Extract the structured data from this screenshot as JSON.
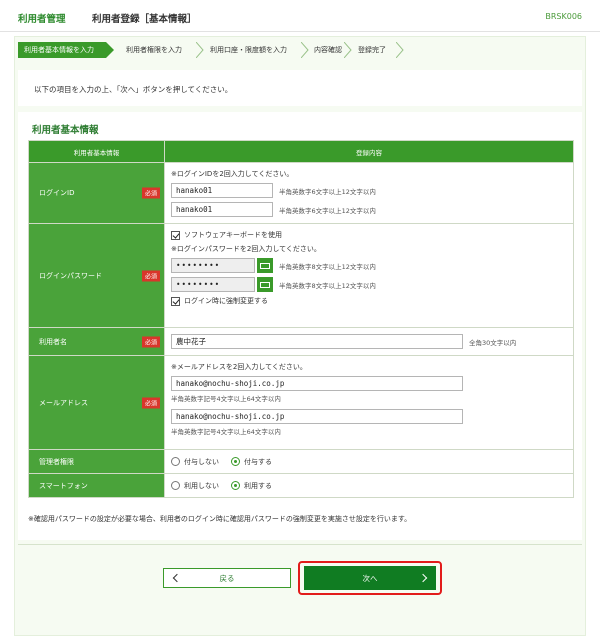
{
  "header": {
    "app_name": "利用者管理",
    "page_title": "利用者登録［基本情報］",
    "screen_code": "BRSK006"
  },
  "steps": [
    {
      "label": "利用者基本情報を入力",
      "active": true
    },
    {
      "label": "利用者権限を入力",
      "active": false
    },
    {
      "label": "利用口座・限度額を入力",
      "active": false
    },
    {
      "label": "内容確認",
      "active": false
    },
    {
      "label": "登録完了",
      "active": false
    }
  ],
  "intro": "以下の項目を入力の上、「次へ」ボタンを押してください。",
  "section_title": "利用者基本情報",
  "table": {
    "col_item": "利用者基本情報",
    "col_content": "登録内容"
  },
  "required_badge": "必須",
  "login_id": {
    "label": "ログインID",
    "note": "※ログインIDを2回入力してください。",
    "value1": "hanako01",
    "value2": "hanako01",
    "hint": "半角英数字6文字以上12文字以内"
  },
  "login_password": {
    "label": "ログインパスワード",
    "software_keyboard": "ソフトウェアキーボードを使用",
    "note": "※ログインパスワードを2回入力してください。",
    "value1": "••••••••",
    "value2": "••••••••",
    "hint": "半角英数字8文字以上12文字以内",
    "force_change": "ログイン時に強制変更する"
  },
  "user_name": {
    "label": "利用者名",
    "value": "農中花子",
    "hint": "全角30文字以内"
  },
  "email": {
    "label": "メールアドレス",
    "note": "※メールアドレスを2回入力してください。",
    "value1": "hanako@nochu-shoji.co.jp",
    "value2": "hanako@nochu-shoji.co.jp",
    "hint": "半角英数字記号4文字以上64文字以内"
  },
  "admin": {
    "label": "管理者権限",
    "option_off": "付与しない",
    "option_on": "付与する"
  },
  "smartphone": {
    "label": "スマートフォン",
    "option_off": "利用しない",
    "option_on": "利用する"
  },
  "footnote": "※確認用パスワードの設定が必要な場合、利用者のログイン時に確認用パスワードの強制変更を実施させ設定を行います。",
  "buttons": {
    "back": "戻る",
    "next": "次へ"
  },
  "colors": {
    "accent": "#3a9a2a",
    "next_button": "#107c22",
    "highlight": "#e21b1b",
    "required": "#d9362b"
  }
}
